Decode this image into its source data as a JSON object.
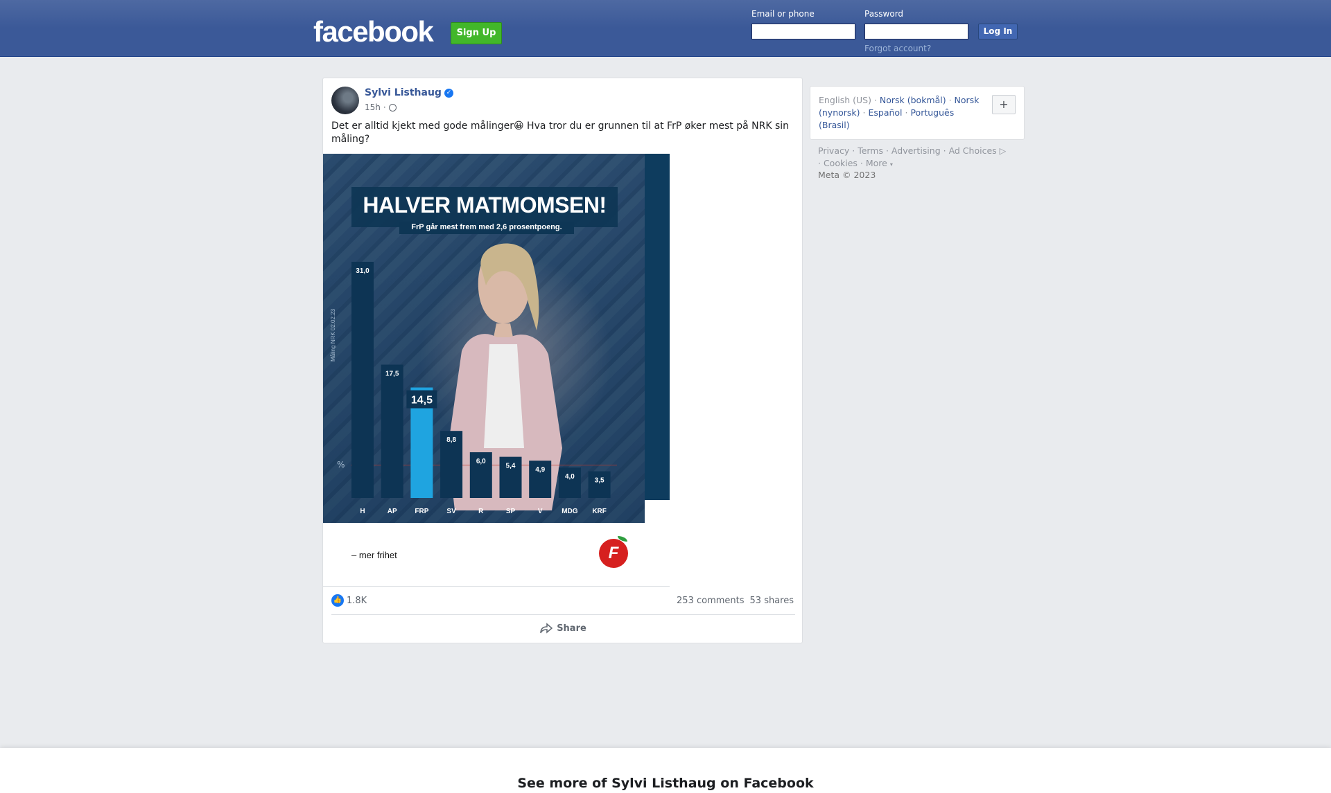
{
  "header": {
    "logo": "facebook",
    "signup_label": "Sign Up",
    "email_label": "Email or phone",
    "password_label": "Password",
    "email_value": "",
    "password_value": "",
    "login_label": "Log In",
    "forgot_label": "Forgot account?"
  },
  "post": {
    "author": "Sylvi Listhaug",
    "time": "15h",
    "text": "Det er alltid kjekt med gode målinger😀 Hva tror du er grunnen til at FrP øker mest på NRK sin måling?",
    "likes": "1.8K",
    "comments": "253 comments",
    "shares": "53 shares",
    "share_label": "Share",
    "image": {
      "title": "HALVER MATMOMSEN!",
      "subtitle": "FrP går mest frem med 2,6 prosentpoeng.",
      "vertical_label": "Måling NRK 02.02.23",
      "unit_label": "%",
      "caption": "– mer frihet",
      "logo_letter": "F"
    }
  },
  "chart_data": {
    "type": "bar",
    "categories": [
      "H",
      "AP",
      "FRP",
      "SV",
      "R",
      "SP",
      "V",
      "MDG",
      "KRF"
    ],
    "values": [
      31.0,
      17.5,
      14.5,
      8.8,
      6.0,
      5.4,
      4.9,
      4.0,
      3.5
    ],
    "labels": [
      "31,0",
      "17,5",
      "14,5",
      "8,8",
      "6,0",
      "5,4",
      "4,9",
      "4,0",
      "3,5"
    ],
    "highlight": "FRP",
    "colors": {
      "bar": "#0d3454",
      "highlight": "#1fa4e0"
    },
    "ylim": [
      0,
      31
    ]
  },
  "sidebar": {
    "current_language": "English (US)",
    "languages": [
      "Norsk (bokmål)",
      "Norsk (nynorsk)",
      "Español",
      "Português (Brasil)"
    ],
    "plus_label": "+",
    "footer": [
      "Privacy",
      "Terms",
      "Advertising",
      "Ad Choices",
      "Cookies",
      "More"
    ],
    "copyright": "Meta © 2023"
  },
  "bottom_banner": "See more of Sylvi Listhaug on Facebook"
}
